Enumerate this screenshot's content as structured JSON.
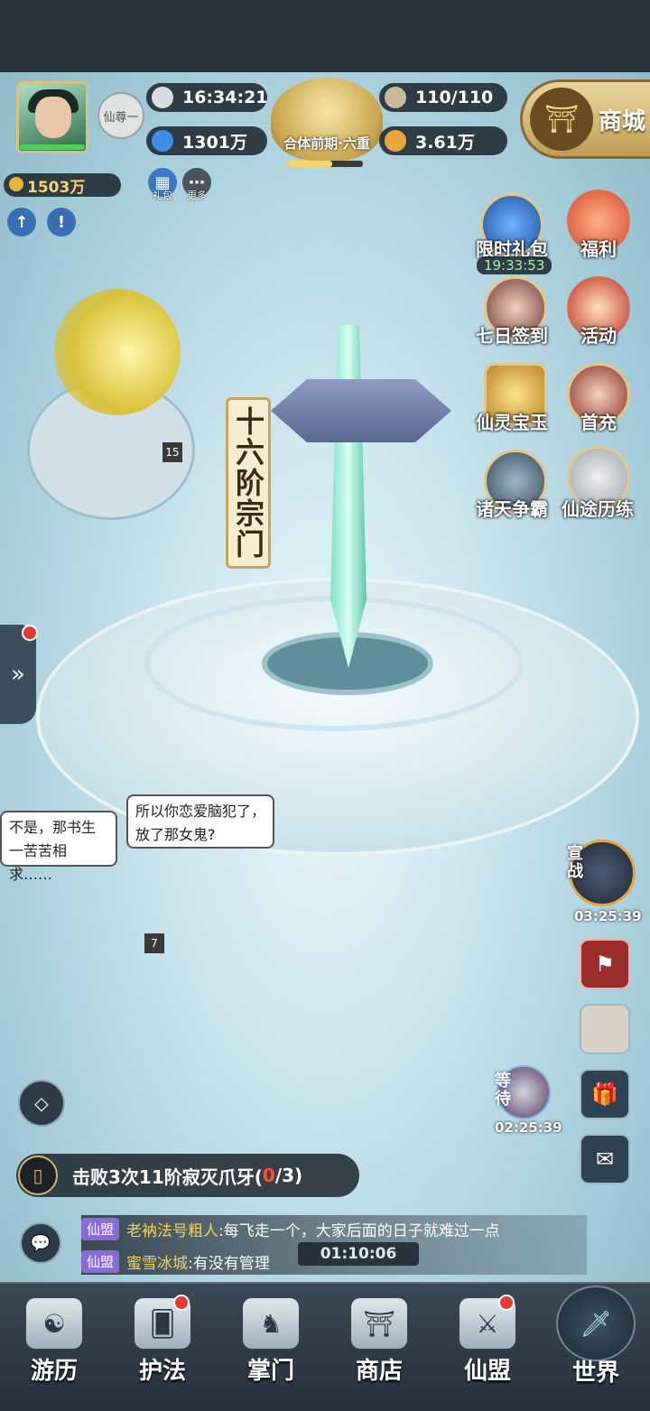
{
  "player": {
    "rank_title": "仙尊一",
    "time": "16:34:21",
    "spirit_stones": "1301万",
    "stamina": "110/110",
    "power": "3.61万",
    "gold": "1503万",
    "realm": "合体前期·六重",
    "realm_progress": 0.6
  },
  "shop_button": {
    "label": "商城"
  },
  "quick_buttons": [
    {
      "label": "礼包",
      "icon": "gift-icon"
    },
    {
      "label": "更多",
      "icon": "more-icon"
    }
  ],
  "events": [
    {
      "label": "限时礼包",
      "timer": "19:33:53",
      "icon": "gem-icon"
    },
    {
      "label": "福利",
      "icon": "giftbag-icon"
    },
    {
      "label": "七日签到",
      "icon": "portrait-icon"
    },
    {
      "label": "活动",
      "icon": "scroll-icon"
    },
    {
      "label": "仙灵宝玉",
      "icon": "chest-icon"
    },
    {
      "label": "首充",
      "icon": "mask-icon"
    },
    {
      "label": "诸天争霸",
      "icon": "battle-icon"
    },
    {
      "label": "仙途历练",
      "icon": "sage-icon"
    }
  ],
  "sect_banner": "十六阶宗门",
  "map_levels": {
    "left_isle": "15",
    "left_tower": "7"
  },
  "dialog": {
    "left": "不是，那书生一苦苦相求……",
    "right": "所以你恋爱脑犯了，放了那女鬼?"
  },
  "war": {
    "label": "宣战",
    "timer": "03:25:39"
  },
  "wait": {
    "label": "等待",
    "timer": "02:25:39"
  },
  "quest": {
    "text": "击败3次11阶寂灭爪牙(",
    "progress": "0",
    "total": "/3)"
  },
  "chat": {
    "timer": "01:10:06",
    "messages": [
      {
        "tag": "仙盟",
        "name": "老衲法号粗人",
        "text": ":每飞走一个，大家后面的日子就难过一点"
      },
      {
        "tag": "仙盟",
        "name": "蜜雪冰城",
        "text": ":有没有管理"
      }
    ]
  },
  "nav": [
    {
      "label": "游历",
      "icon": "yinyang-icon",
      "badge": false
    },
    {
      "label": "护法",
      "icon": "cards-icon",
      "badge": true
    },
    {
      "label": "掌门",
      "icon": "beast-icon",
      "badge": false
    },
    {
      "label": "商店",
      "icon": "pavilion-icon",
      "badge": false
    },
    {
      "label": "仙盟",
      "icon": "alliance-icon",
      "badge": true
    },
    {
      "label": "世界",
      "icon": "sword-icon",
      "badge": false
    }
  ]
}
